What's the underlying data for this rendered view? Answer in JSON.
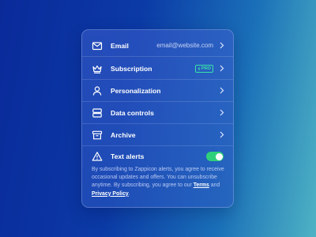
{
  "settings": {
    "rows": [
      {
        "label": "Email",
        "value": "email@website.com",
        "icon": "envelope-icon"
      },
      {
        "label": "Subscription",
        "badge": "PRO",
        "icon": "crown-icon"
      },
      {
        "label": "Personalization",
        "icon": "user-icon"
      },
      {
        "label": "Data controls",
        "icon": "server-icon"
      },
      {
        "label": "Archive",
        "icon": "archive-box-icon"
      }
    ],
    "alerts": {
      "label": "Text alerts",
      "icon": "warning-triangle-icon",
      "enabled": true,
      "desc_prefix": "By subscribing to Zappicon alerts, you agree to receive occasional updates and offers. You can unsubscribe anytime. By subscribing, you agree to our",
      "terms": "Terms",
      "and": "and",
      "privacy": "Privacy Policy",
      "end": "."
    }
  },
  "colors": {
    "toggle_on": "#2fd07a",
    "badge": "#38e2a8"
  }
}
